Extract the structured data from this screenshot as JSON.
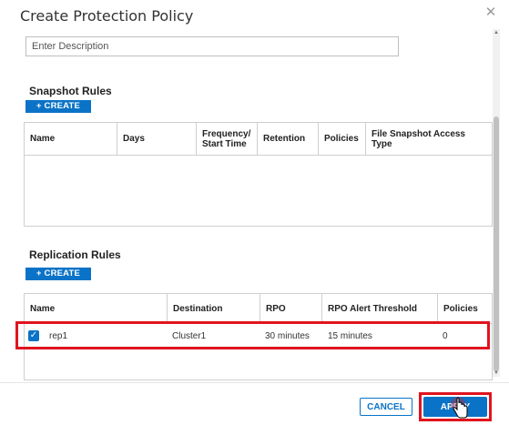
{
  "dialog": {
    "title": "Create Protection Policy",
    "close_icon": "close-icon"
  },
  "description": {
    "placeholder": "Enter Description",
    "value": ""
  },
  "snapshot": {
    "title": "Snapshot Rules",
    "create_label": "+ CREATE",
    "columns": [
      "Name",
      "Days",
      "Frequency/ Start Time",
      "Retention",
      "Policies",
      "File Snapshot Access Type"
    ],
    "rows": []
  },
  "replication": {
    "title": "Replication Rules",
    "create_label": "+ CREATE",
    "columns": [
      "Name",
      "Destination",
      "RPO",
      "RPO Alert Threshold",
      "Policies"
    ],
    "rows": [
      {
        "checked": true,
        "name": "rep1",
        "destination": "Cluster1",
        "rpo": "30 minutes",
        "threshold": "15 minutes",
        "policies": "0"
      }
    ]
  },
  "footer": {
    "cancel_label": "CANCEL",
    "apply_label": "APPLY"
  },
  "colors": {
    "accent": "#0a73c7",
    "highlight": "#e0141e"
  }
}
